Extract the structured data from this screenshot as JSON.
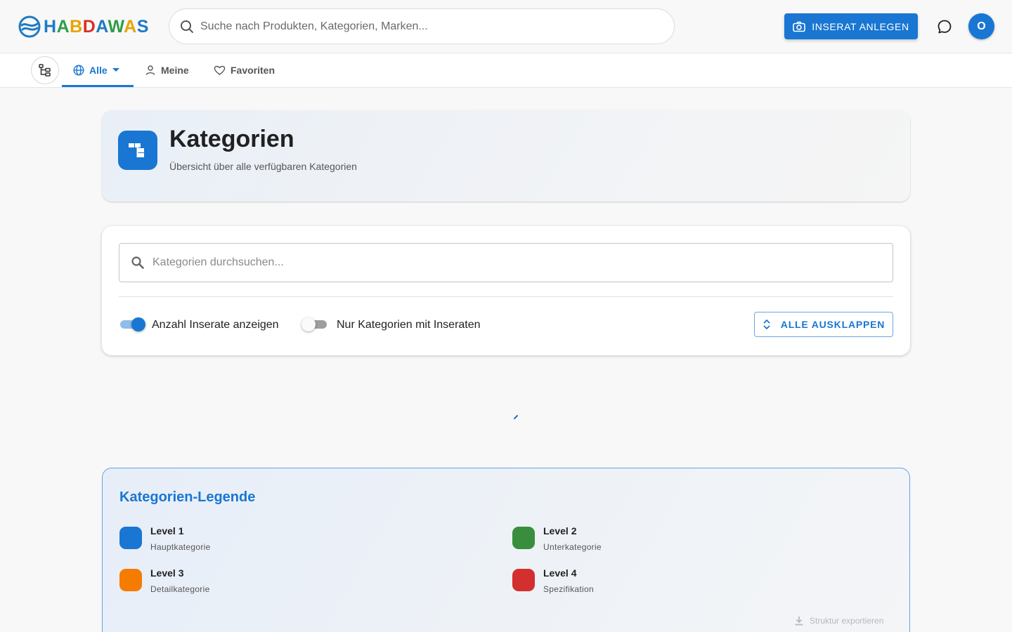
{
  "header": {
    "logo_text": "HABDAWAS",
    "search_placeholder": "Suche nach Produkten, Kategorien, Marken...",
    "create_button_label": "INSERAT ANLEGEN",
    "avatar_initial": "O"
  },
  "nav": {
    "tabs": [
      {
        "label": "Alle",
        "icon": "globe-icon",
        "active": true
      },
      {
        "label": "Meine",
        "icon": "person-icon",
        "active": false
      },
      {
        "label": "Favoriten",
        "icon": "heart-icon",
        "active": false
      }
    ]
  },
  "page": {
    "title": "Kategorien",
    "subtitle": "Übersicht über alle verfügbaren Kategorien"
  },
  "filters": {
    "search_placeholder": "Kategorien durchsuchen...",
    "toggles": [
      {
        "label": "Anzahl Inserate anzeigen",
        "on": true
      },
      {
        "label": "Nur Kategorien mit Inseraten",
        "on": false
      }
    ],
    "expand_button_label": "ALLE AUSKLAPPEN"
  },
  "legend": {
    "title": "Kategorien-Legende",
    "items": [
      {
        "name": "Level 1",
        "desc": "Hauptkategorie",
        "color": "#1976d2"
      },
      {
        "name": "Level 2",
        "desc": "Unterkategorie",
        "color": "#388e3c"
      },
      {
        "name": "Level 3",
        "desc": "Detailkategorie",
        "color": "#f57c00"
      },
      {
        "name": "Level 4",
        "desc": "Spezifikation",
        "color": "#d32f2f"
      }
    ],
    "export_label": "Struktur exportieren"
  },
  "colors": {
    "primary": "#1976d2",
    "background": "#f8f8f8"
  }
}
